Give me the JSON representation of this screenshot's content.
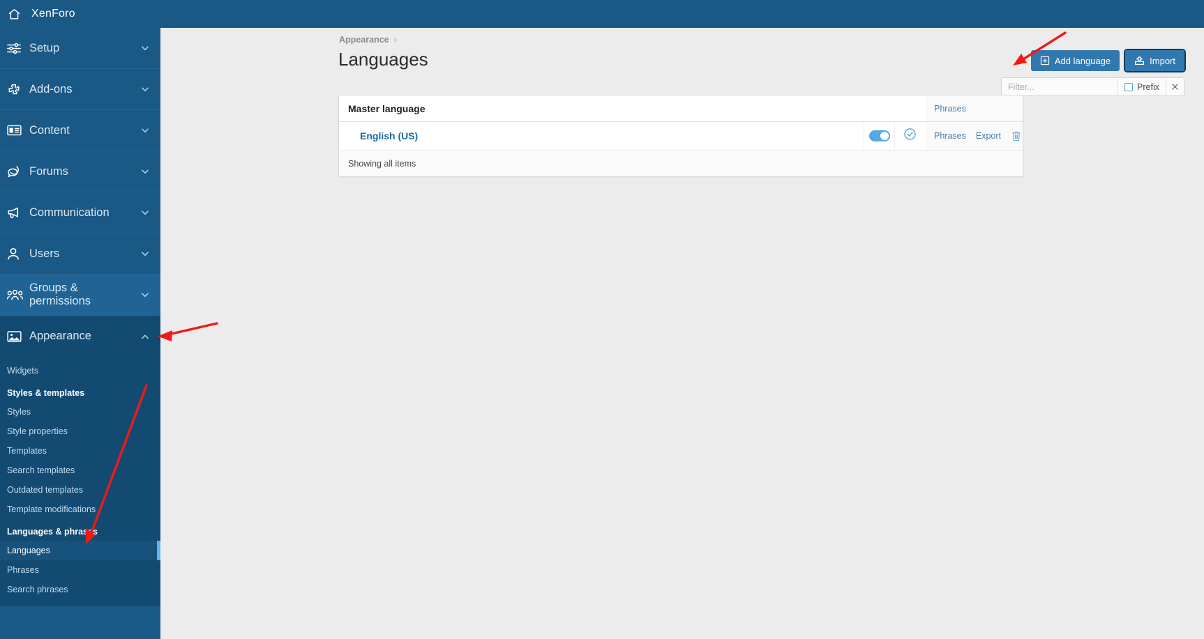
{
  "topbar": {
    "home_icon": "home-icon",
    "title": "XenForo"
  },
  "sidebar": {
    "groups": [
      {
        "label": "Setup",
        "icon": "sliders-icon",
        "chevron": "chevron-down-icon",
        "expanded": false
      },
      {
        "label": "Add-ons",
        "icon": "puzzle-icon",
        "chevron": "chevron-down-icon",
        "expanded": false
      },
      {
        "label": "Content",
        "icon": "article-icon",
        "chevron": "chevron-down-icon",
        "expanded": false
      },
      {
        "label": "Forums",
        "icon": "comments-icon",
        "chevron": "chevron-down-icon",
        "expanded": false
      },
      {
        "label": "Communication",
        "icon": "megaphone-icon",
        "chevron": "chevron-down-icon",
        "expanded": false
      },
      {
        "label": "Users",
        "icon": "user-icon",
        "chevron": "chevron-down-icon",
        "expanded": false
      },
      {
        "label": "Groups & permissions",
        "icon": "users-group-icon",
        "chevron": "chevron-down-icon",
        "expanded": false
      },
      {
        "label": "Appearance",
        "icon": "image-icon",
        "chevron": "chevron-up-icon",
        "expanded": true
      }
    ],
    "appearance_sub": {
      "widgets": "Widgets",
      "styles_templates_heading": "Styles & templates",
      "styles": "Styles",
      "style_properties": "Style properties",
      "templates": "Templates",
      "search_templates": "Search templates",
      "outdated_templates": "Outdated templates",
      "template_modifications": "Template modifications",
      "languages_phrases_heading": "Languages & phrases",
      "languages": "Languages",
      "phrases": "Phrases",
      "search_phrases": "Search phrases"
    }
  },
  "main": {
    "breadcrumb": {
      "parent": "Appearance",
      "separator": "›"
    },
    "page_title": "Languages",
    "buttons": {
      "add_language": "Add language",
      "add_language_icon": "plus-square-icon",
      "import": "Import",
      "import_icon": "import-icon"
    },
    "filter": {
      "placeholder": "Filter...",
      "value": "",
      "prefix_label": "Prefix",
      "prefix_checked": false,
      "clear_icon": "close-icon"
    },
    "table": {
      "header": {
        "name_column": "Master language",
        "phrases_column": "Phrases"
      },
      "rows": [
        {
          "name": "English (US)",
          "enabled": true,
          "toggle_icon": "toggle-on-icon",
          "default_icon": "check-circle-icon",
          "phrases_link": "Phrases",
          "export_link": "Export",
          "delete_icon": "trash-icon"
        }
      ],
      "footer": "Showing all items"
    }
  },
  "colors": {
    "brand_blue": "#1a5886",
    "sidebar_expanded": "#134a72",
    "button_blue": "#3178ae",
    "link_blue": "#1a6ba5",
    "accent_bar": "#62b4ea",
    "annotation_red": "#ef1a17",
    "page_bg": "#ececec"
  }
}
